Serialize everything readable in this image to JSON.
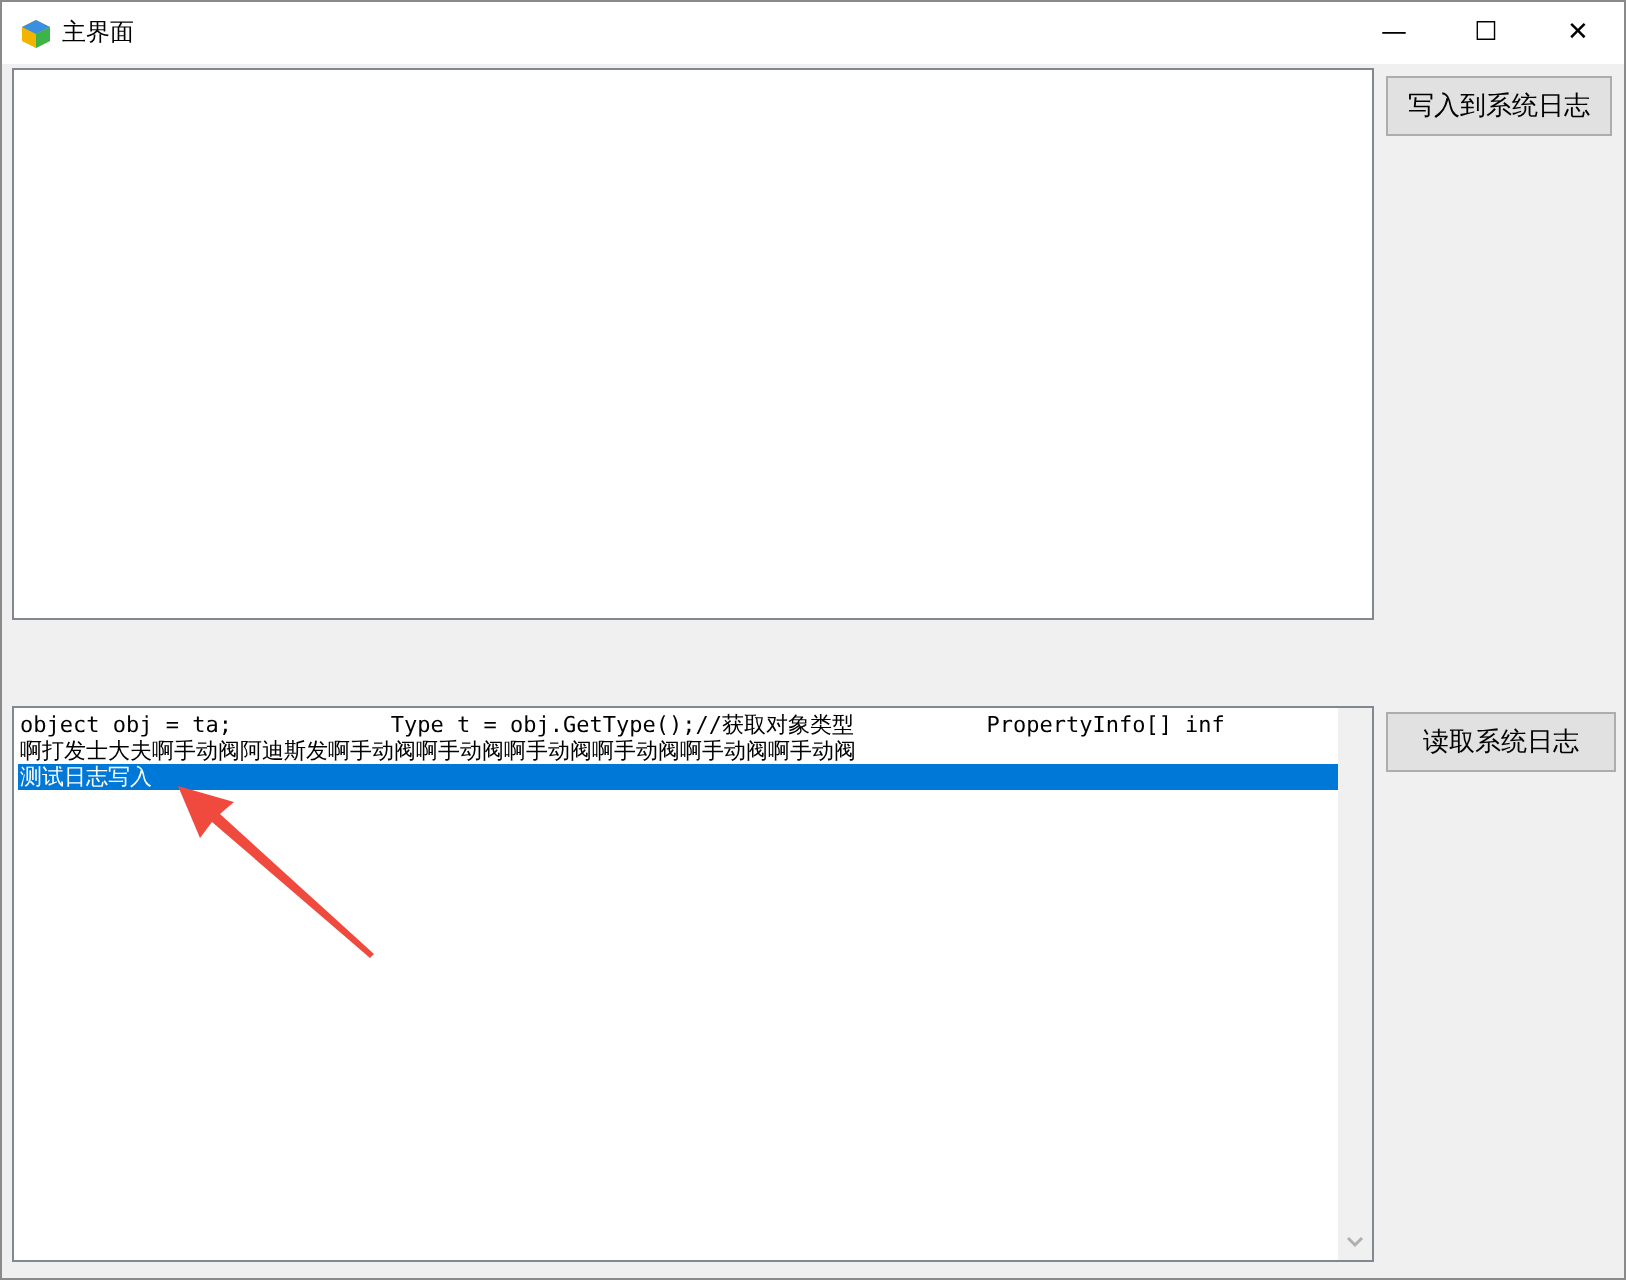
{
  "window": {
    "title": "主界面",
    "controls": [
      "—",
      "☐",
      "✕"
    ]
  },
  "write_button": {
    "label": "写入到系统日志"
  },
  "log_list": {
    "items": [
      {
        "text": "object obj = ta;            Type t = obj.GetType();//获取对象类型          PropertyInfo[] inf",
        "selected": false
      },
      {
        "text": "啊打发士大夫啊手动阀阿迪斯发啊手动阀啊手动阀啊手动阀啊手动阀啊手动阀啊手动阀",
        "selected": false
      },
      {
        "text": "测试日志写入",
        "selected": true
      }
    ]
  },
  "read_button": {
    "label": "读取系统日志"
  }
}
